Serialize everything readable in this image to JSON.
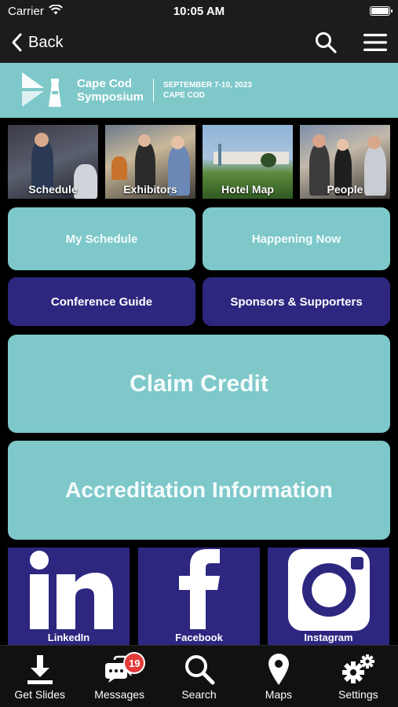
{
  "status": {
    "carrier": "Carrier",
    "time": "10:05 AM"
  },
  "nav": {
    "back_label": "Back"
  },
  "banner": {
    "title": "Cape Cod\nSymposium",
    "dates": "SEPTEMBER 7-10, 2023",
    "location": "CAPE COD"
  },
  "tiles": [
    {
      "label": "Schedule"
    },
    {
      "label": "Exhibitors"
    },
    {
      "label": "Hotel Map"
    },
    {
      "label": "People"
    }
  ],
  "buttons": {
    "my_schedule": "My Schedule",
    "happening_now": "Happening Now",
    "conference_guide": "Conference Guide",
    "sponsors": "Sponsors & Supporters",
    "claim_credit": "Claim Credit",
    "accreditation": "Accreditation Information"
  },
  "social": {
    "linkedin": "LinkedIn",
    "facebook": "Facebook",
    "instagram": "Instagram"
  },
  "tabbar": {
    "get_slides": "Get Slides",
    "messages": "Messages",
    "messages_badge": "19",
    "search": "Search",
    "maps": "Maps",
    "settings": "Settings"
  },
  "colors": {
    "teal": "#7ec8ca",
    "indigo": "#2d2780",
    "badge": "#e43b3b"
  }
}
